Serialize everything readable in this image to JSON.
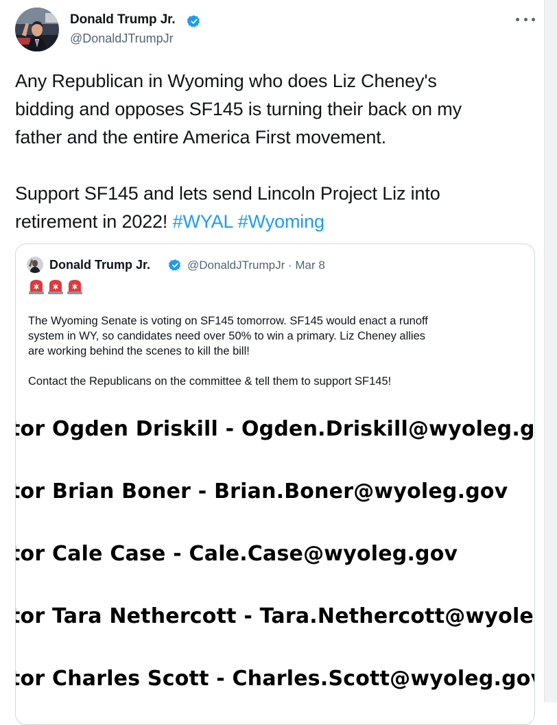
{
  "tweet": {
    "author_name": "Donald Trump Jr.",
    "author_handle": "@DonaldJTrumpJr",
    "text_main": "Any Republican in Wyoming who does Liz Cheney's\nbidding and opposes SF145 is turning their back on my\nfather and the entire America First movement.\n\nSupport SF145 and lets send Lincoln Project Liz into\nretirement in 2022! ",
    "hashtags": [
      "#WYAL",
      "#Wyoming"
    ],
    "more_icon": "more-horizontal-icon",
    "verified_icon": "verified-badge-icon"
  },
  "quoted_tweet": {
    "author_name": "Donald Trump Jr.",
    "meta": "@DonaldJTrumpJr · Mar 8",
    "emojis": [
      "siren-emoji",
      "siren-emoji",
      "siren-emoji"
    ],
    "text": "The Wyoming Senate is voting on SF145 tomorrow. SF145 would enact a runoff\nsystem in WY, so candidates need over 50% to win a primary. Liz Cheney allies\nare working behind the scenes to kill the bill!\n\nContact the Republicans on the committee & tell them to support SF145!",
    "image_lines": [
      "tor Ogden Driskill - Ogden.Driskill@wyoleg.gov",
      "tor Brian Boner - Brian.Boner@wyoleg.gov",
      "tor Cale Case - Cale.Case@wyoleg.gov",
      "tor Tara Nethercott - Tara.Nethercott@wyoleg.gov",
      "tor Charles Scott - Charles.Scott@wyoleg.gov"
    ]
  },
  "colors": {
    "accent": "#1d9bf0",
    "text": "#0f1419",
    "secondary": "#536471",
    "border": "#cfd9de"
  }
}
